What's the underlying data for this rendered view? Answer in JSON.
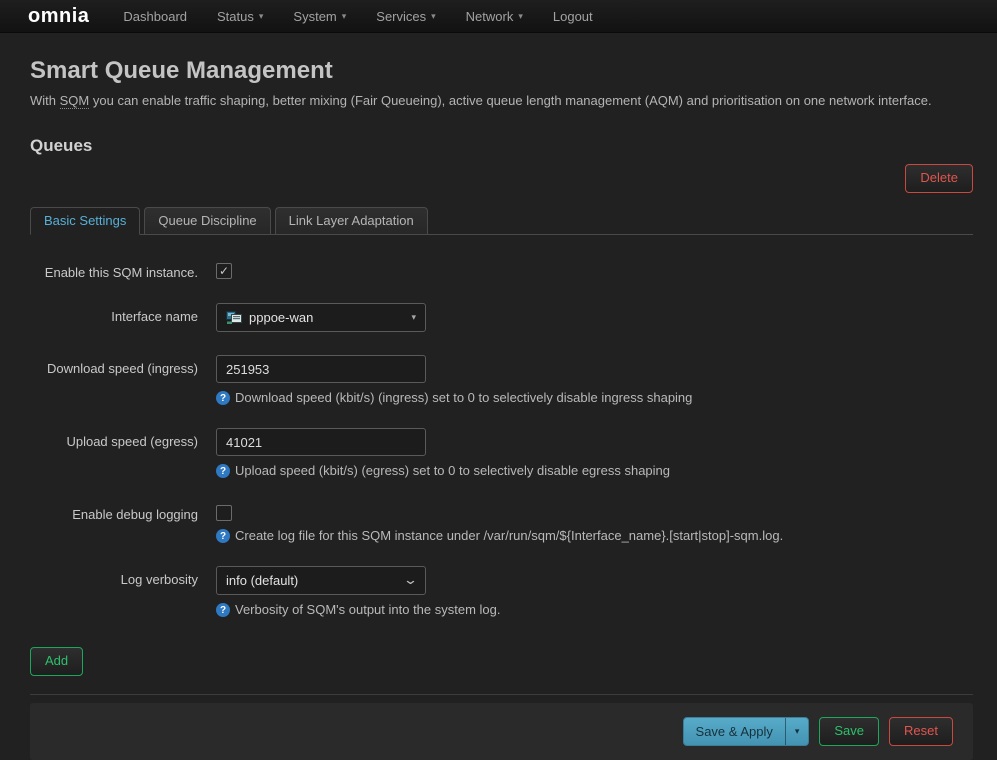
{
  "icons": {
    "caret_down": "▾",
    "chevron_down": "⌄",
    "check": "✓",
    "help": "?"
  },
  "navbar": {
    "logo": "omnia",
    "items": [
      {
        "label": "Dashboard"
      },
      {
        "label": "Status"
      },
      {
        "label": "System"
      },
      {
        "label": "Services"
      },
      {
        "label": "Network"
      },
      {
        "label": "Logout"
      }
    ]
  },
  "page": {
    "title": "Smart Queue Management",
    "intro_prefix": "With",
    "intro_abbr": "SQM",
    "intro_suffix": "you can enable traffic shaping, better mixing (Fair Queueing), active queue length management (AQM) and prioritisation on one network interface.",
    "section_title": "Queues"
  },
  "tabs": [
    {
      "label": "Basic Settings"
    },
    {
      "label": "Queue Discipline"
    },
    {
      "label": "Link Layer Adaptation"
    }
  ],
  "buttons": {
    "delete": "Delete",
    "add": "Add",
    "save_apply": "Save & Apply",
    "save": "Save",
    "reset": "Reset"
  },
  "form": {
    "fields": [
      {
        "label": "Enable this SQM instance."
      },
      {
        "label": "Interface name",
        "value": "pppoe-wan"
      },
      {
        "label": "Download speed (ingress)",
        "value": "251953",
        "help": "Download speed (kbit/s) (ingress) set to 0 to selectively disable ingress shaping"
      },
      {
        "label": "Upload speed (egress)",
        "value": "41021",
        "help": "Upload speed (kbit/s) (egress) set to 0 to selectively disable egress shaping"
      },
      {
        "label": "Enable debug logging",
        "help": "Create log file for this SQM instance under /var/run/sqm/${Interface_name}.[start|stop]-sqm.log."
      },
      {
        "label": "Log verbosity",
        "value": "info (default)",
        "help": "Verbosity of SQM's output into the system log."
      }
    ]
  },
  "colors": {
    "accent_teal": "#4c9dbd",
    "tab_active": "#57b0d6",
    "green": "#2ec06c",
    "red": "#e0564e",
    "help_icon_bg": "#2f78c2"
  }
}
